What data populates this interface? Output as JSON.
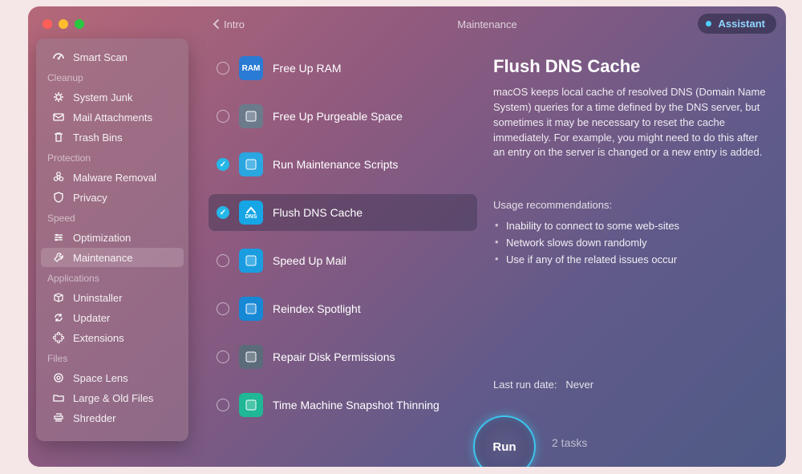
{
  "header": {
    "back_label": "Intro",
    "title": "Maintenance",
    "assistant_label": "Assistant"
  },
  "sidebar": {
    "groups": [
      {
        "label": "",
        "items": [
          {
            "label": "Smart Scan",
            "icon": "gauge-icon"
          }
        ]
      },
      {
        "label": "Cleanup",
        "items": [
          {
            "label": "System Junk",
            "icon": "gear-icon"
          },
          {
            "label": "Mail Attachments",
            "icon": "envelope-icon"
          },
          {
            "label": "Trash Bins",
            "icon": "trash-icon"
          }
        ]
      },
      {
        "label": "Protection",
        "items": [
          {
            "label": "Malware Removal",
            "icon": "biohazard-icon"
          },
          {
            "label": "Privacy",
            "icon": "shield-icon"
          }
        ]
      },
      {
        "label": "Speed",
        "items": [
          {
            "label": "Optimization",
            "icon": "sliders-icon"
          },
          {
            "label": "Maintenance",
            "icon": "wrench-icon",
            "active": true
          }
        ]
      },
      {
        "label": "Applications",
        "items": [
          {
            "label": "Uninstaller",
            "icon": "package-icon"
          },
          {
            "label": "Updater",
            "icon": "refresh-icon"
          },
          {
            "label": "Extensions",
            "icon": "puzzle-icon"
          }
        ]
      },
      {
        "label": "Files",
        "items": [
          {
            "label": "Space Lens",
            "icon": "lens-icon"
          },
          {
            "label": "Large & Old Files",
            "icon": "folder-icon"
          },
          {
            "label": "Shredder",
            "icon": "shredder-icon"
          }
        ]
      }
    ]
  },
  "tasks": [
    {
      "label": "Free Up RAM",
      "checked": false,
      "selected": false,
      "icon_bg": "#2a7bd4",
      "icon_text": "RAM"
    },
    {
      "label": "Free Up Purgeable Space",
      "checked": false,
      "selected": false,
      "icon_bg": "#6b7b8c",
      "icon_text": ""
    },
    {
      "label": "Run Maintenance Scripts",
      "checked": true,
      "selected": false,
      "icon_bg": "#2aa6e0",
      "icon_text": ""
    },
    {
      "label": "Flush DNS Cache",
      "checked": true,
      "selected": true,
      "icon_bg": "#16a6e6",
      "icon_text": "DNS"
    },
    {
      "label": "Speed Up Mail",
      "checked": false,
      "selected": false,
      "icon_bg": "#1a9de0",
      "icon_text": ""
    },
    {
      "label": "Reindex Spotlight",
      "checked": false,
      "selected": false,
      "icon_bg": "#1688d6",
      "icon_text": ""
    },
    {
      "label": "Repair Disk Permissions",
      "checked": false,
      "selected": false,
      "icon_bg": "#5b6b7a",
      "icon_text": ""
    },
    {
      "label": "Time Machine Snapshot Thinning",
      "checked": false,
      "selected": false,
      "icon_bg": "#1fb795",
      "icon_text": ""
    }
  ],
  "detail": {
    "title": "Flush DNS Cache",
    "description": "macOS keeps local cache of resolved DNS (Domain Name System) queries for a time defined by the DNS server, but sometimes it may be necessary to reset the cache immediately. For example, you might need to do this after an entry on the server is changed or a new entry is added.",
    "usage_title": "Usage recommendations:",
    "usage": [
      "Inability to connect to some web-sites",
      "Network slows down randomly",
      "Use if any of the related issues occur"
    ],
    "last_run_label": "Last run date:",
    "last_run_value": "Never"
  },
  "run": {
    "label": "Run",
    "count_label": "2 tasks"
  }
}
